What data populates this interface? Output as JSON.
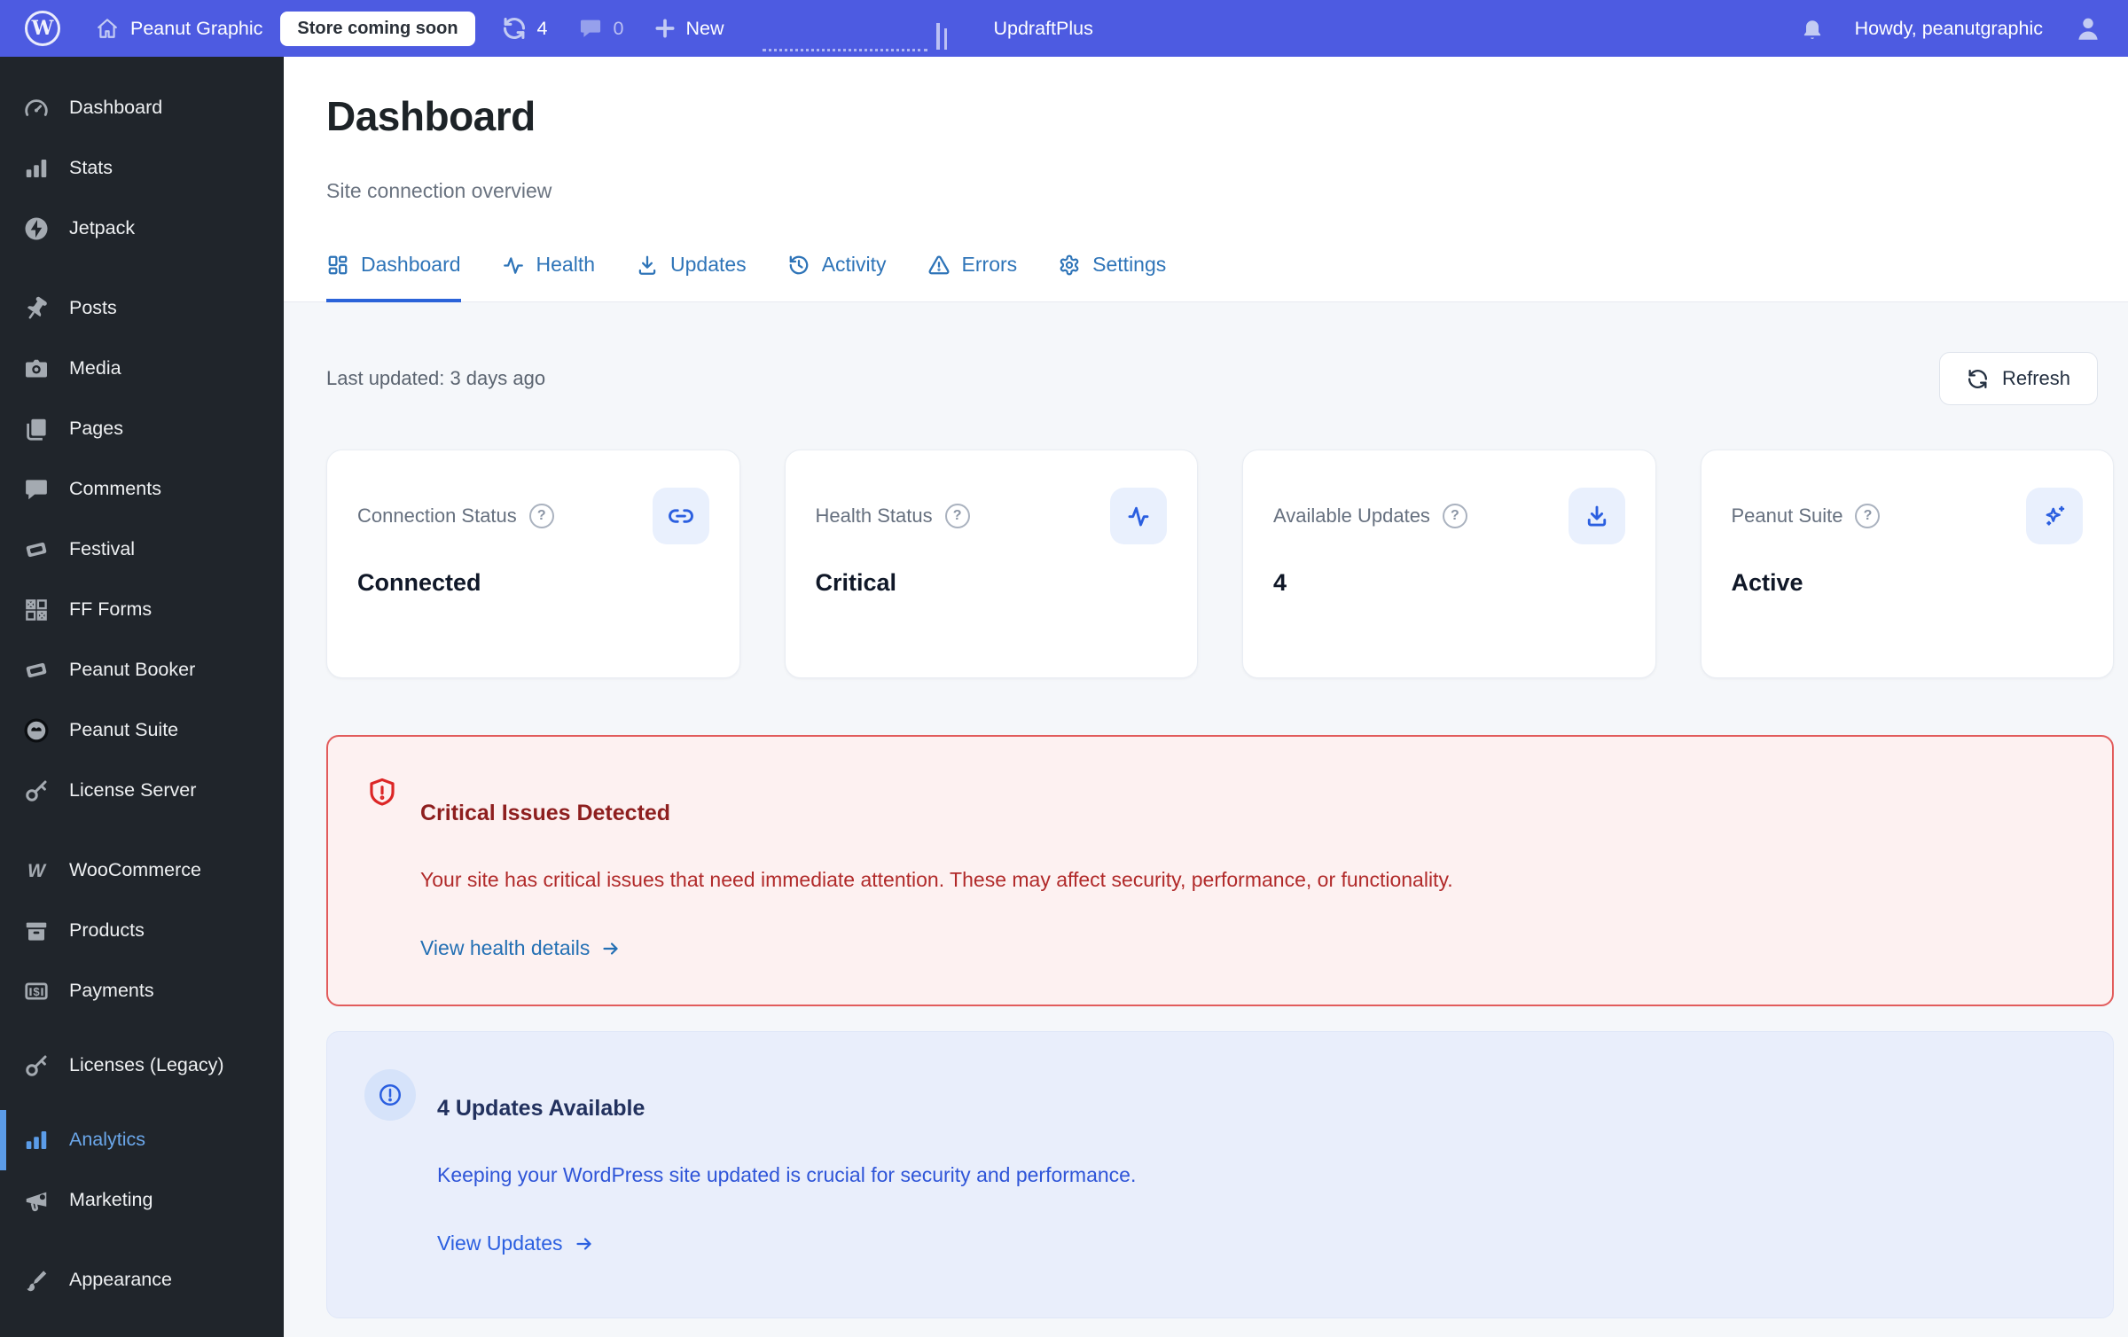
{
  "admin_bar": {
    "site_name": "Peanut Graphic",
    "badge": "Store coming soon",
    "updates_count": "4",
    "comments_count": "0",
    "new_label": "New",
    "plugin_label": "UpdraftPlus",
    "howdy": "Howdy, peanutgraphic"
  },
  "sidebar": {
    "items": [
      {
        "label": "Dashboard"
      },
      {
        "label": "Stats"
      },
      {
        "label": "Jetpack"
      },
      {
        "label": "Posts"
      },
      {
        "label": "Media"
      },
      {
        "label": "Pages"
      },
      {
        "label": "Comments"
      },
      {
        "label": "Festival"
      },
      {
        "label": "FF Forms"
      },
      {
        "label": "Peanut Booker"
      },
      {
        "label": "Peanut Suite"
      },
      {
        "label": "License Server"
      },
      {
        "label": "WooCommerce"
      },
      {
        "label": "Products"
      },
      {
        "label": "Payments"
      },
      {
        "label": "Licenses (Legacy)"
      },
      {
        "label": "Analytics",
        "active": true
      },
      {
        "label": "Marketing"
      },
      {
        "label": "Appearance"
      }
    ]
  },
  "page": {
    "title": "Dashboard",
    "subtitle": "Site connection overview",
    "tabs": [
      {
        "label": "Dashboard",
        "active": true
      },
      {
        "label": "Health"
      },
      {
        "label": "Updates"
      },
      {
        "label": "Activity"
      },
      {
        "label": "Errors"
      },
      {
        "label": "Settings"
      }
    ],
    "last_updated": "Last updated: 3 days ago",
    "refresh_label": "Refresh"
  },
  "cards": [
    {
      "title": "Connection Status",
      "value": "Connected",
      "icon": "link-icon"
    },
    {
      "title": "Health Status",
      "value": "Critical",
      "icon": "activity-icon"
    },
    {
      "title": "Available Updates",
      "value": "4",
      "icon": "download-icon"
    },
    {
      "title": "Peanut Suite",
      "value": "Active",
      "icon": "sparkles-icon"
    }
  ],
  "alerts": {
    "critical": {
      "title": "Critical Issues Detected",
      "body": "Your site has critical issues that need immediate attention. These may affect security, performance, or functionality.",
      "link": "View health details"
    },
    "updates": {
      "title": "4 Updates Available",
      "body": "Keeping your WordPress site updated is crucial for security and performance.",
      "link": "View Updates"
    }
  },
  "glyphs": {
    "wp": "W",
    "woocommerce": "W",
    "help": "?",
    "payments_dollar": "$"
  },
  "colors": {
    "topbar": "#4d5be1",
    "sidebar": "#20252b",
    "accent_blue": "#2b5fe0",
    "tab_blue": "#2e74b8",
    "active_menu": "#6ba7ea",
    "critical_red": "#dc2626",
    "content_bg": "#f5f7fa"
  }
}
